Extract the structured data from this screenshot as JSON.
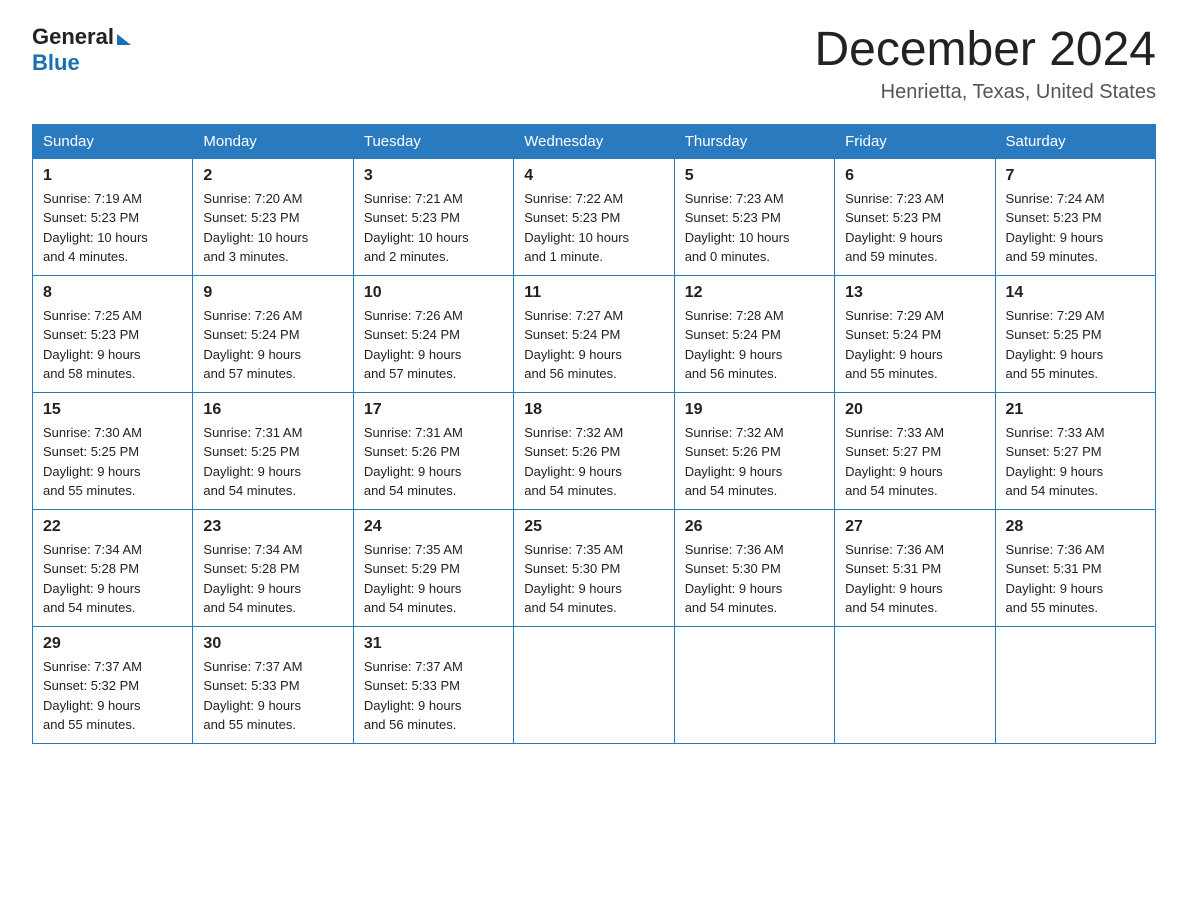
{
  "header": {
    "logo_general": "General",
    "logo_blue": "Blue",
    "title": "December 2024",
    "subtitle": "Henrietta, Texas, United States"
  },
  "days_of_week": [
    "Sunday",
    "Monday",
    "Tuesday",
    "Wednesday",
    "Thursday",
    "Friday",
    "Saturday"
  ],
  "weeks": [
    [
      {
        "day": "1",
        "sunrise": "Sunrise: 7:19 AM",
        "sunset": "Sunset: 5:23 PM",
        "daylight": "Daylight: 10 hours",
        "daylight2": "and 4 minutes."
      },
      {
        "day": "2",
        "sunrise": "Sunrise: 7:20 AM",
        "sunset": "Sunset: 5:23 PM",
        "daylight": "Daylight: 10 hours",
        "daylight2": "and 3 minutes."
      },
      {
        "day": "3",
        "sunrise": "Sunrise: 7:21 AM",
        "sunset": "Sunset: 5:23 PM",
        "daylight": "Daylight: 10 hours",
        "daylight2": "and 2 minutes."
      },
      {
        "day": "4",
        "sunrise": "Sunrise: 7:22 AM",
        "sunset": "Sunset: 5:23 PM",
        "daylight": "Daylight: 10 hours",
        "daylight2": "and 1 minute."
      },
      {
        "day": "5",
        "sunrise": "Sunrise: 7:23 AM",
        "sunset": "Sunset: 5:23 PM",
        "daylight": "Daylight: 10 hours",
        "daylight2": "and 0 minutes."
      },
      {
        "day": "6",
        "sunrise": "Sunrise: 7:23 AM",
        "sunset": "Sunset: 5:23 PM",
        "daylight": "Daylight: 9 hours",
        "daylight2": "and 59 minutes."
      },
      {
        "day": "7",
        "sunrise": "Sunrise: 7:24 AM",
        "sunset": "Sunset: 5:23 PM",
        "daylight": "Daylight: 9 hours",
        "daylight2": "and 59 minutes."
      }
    ],
    [
      {
        "day": "8",
        "sunrise": "Sunrise: 7:25 AM",
        "sunset": "Sunset: 5:23 PM",
        "daylight": "Daylight: 9 hours",
        "daylight2": "and 58 minutes."
      },
      {
        "day": "9",
        "sunrise": "Sunrise: 7:26 AM",
        "sunset": "Sunset: 5:24 PM",
        "daylight": "Daylight: 9 hours",
        "daylight2": "and 57 minutes."
      },
      {
        "day": "10",
        "sunrise": "Sunrise: 7:26 AM",
        "sunset": "Sunset: 5:24 PM",
        "daylight": "Daylight: 9 hours",
        "daylight2": "and 57 minutes."
      },
      {
        "day": "11",
        "sunrise": "Sunrise: 7:27 AM",
        "sunset": "Sunset: 5:24 PM",
        "daylight": "Daylight: 9 hours",
        "daylight2": "and 56 minutes."
      },
      {
        "day": "12",
        "sunrise": "Sunrise: 7:28 AM",
        "sunset": "Sunset: 5:24 PM",
        "daylight": "Daylight: 9 hours",
        "daylight2": "and 56 minutes."
      },
      {
        "day": "13",
        "sunrise": "Sunrise: 7:29 AM",
        "sunset": "Sunset: 5:24 PM",
        "daylight": "Daylight: 9 hours",
        "daylight2": "and 55 minutes."
      },
      {
        "day": "14",
        "sunrise": "Sunrise: 7:29 AM",
        "sunset": "Sunset: 5:25 PM",
        "daylight": "Daylight: 9 hours",
        "daylight2": "and 55 minutes."
      }
    ],
    [
      {
        "day": "15",
        "sunrise": "Sunrise: 7:30 AM",
        "sunset": "Sunset: 5:25 PM",
        "daylight": "Daylight: 9 hours",
        "daylight2": "and 55 minutes."
      },
      {
        "day": "16",
        "sunrise": "Sunrise: 7:31 AM",
        "sunset": "Sunset: 5:25 PM",
        "daylight": "Daylight: 9 hours",
        "daylight2": "and 54 minutes."
      },
      {
        "day": "17",
        "sunrise": "Sunrise: 7:31 AM",
        "sunset": "Sunset: 5:26 PM",
        "daylight": "Daylight: 9 hours",
        "daylight2": "and 54 minutes."
      },
      {
        "day": "18",
        "sunrise": "Sunrise: 7:32 AM",
        "sunset": "Sunset: 5:26 PM",
        "daylight": "Daylight: 9 hours",
        "daylight2": "and 54 minutes."
      },
      {
        "day": "19",
        "sunrise": "Sunrise: 7:32 AM",
        "sunset": "Sunset: 5:26 PM",
        "daylight": "Daylight: 9 hours",
        "daylight2": "and 54 minutes."
      },
      {
        "day": "20",
        "sunrise": "Sunrise: 7:33 AM",
        "sunset": "Sunset: 5:27 PM",
        "daylight": "Daylight: 9 hours",
        "daylight2": "and 54 minutes."
      },
      {
        "day": "21",
        "sunrise": "Sunrise: 7:33 AM",
        "sunset": "Sunset: 5:27 PM",
        "daylight": "Daylight: 9 hours",
        "daylight2": "and 54 minutes."
      }
    ],
    [
      {
        "day": "22",
        "sunrise": "Sunrise: 7:34 AM",
        "sunset": "Sunset: 5:28 PM",
        "daylight": "Daylight: 9 hours",
        "daylight2": "and 54 minutes."
      },
      {
        "day": "23",
        "sunrise": "Sunrise: 7:34 AM",
        "sunset": "Sunset: 5:28 PM",
        "daylight": "Daylight: 9 hours",
        "daylight2": "and 54 minutes."
      },
      {
        "day": "24",
        "sunrise": "Sunrise: 7:35 AM",
        "sunset": "Sunset: 5:29 PM",
        "daylight": "Daylight: 9 hours",
        "daylight2": "and 54 minutes."
      },
      {
        "day": "25",
        "sunrise": "Sunrise: 7:35 AM",
        "sunset": "Sunset: 5:30 PM",
        "daylight": "Daylight: 9 hours",
        "daylight2": "and 54 minutes."
      },
      {
        "day": "26",
        "sunrise": "Sunrise: 7:36 AM",
        "sunset": "Sunset: 5:30 PM",
        "daylight": "Daylight: 9 hours",
        "daylight2": "and 54 minutes."
      },
      {
        "day": "27",
        "sunrise": "Sunrise: 7:36 AM",
        "sunset": "Sunset: 5:31 PM",
        "daylight": "Daylight: 9 hours",
        "daylight2": "and 54 minutes."
      },
      {
        "day": "28",
        "sunrise": "Sunrise: 7:36 AM",
        "sunset": "Sunset: 5:31 PM",
        "daylight": "Daylight: 9 hours",
        "daylight2": "and 55 minutes."
      }
    ],
    [
      {
        "day": "29",
        "sunrise": "Sunrise: 7:37 AM",
        "sunset": "Sunset: 5:32 PM",
        "daylight": "Daylight: 9 hours",
        "daylight2": "and 55 minutes."
      },
      {
        "day": "30",
        "sunrise": "Sunrise: 7:37 AM",
        "sunset": "Sunset: 5:33 PM",
        "daylight": "Daylight: 9 hours",
        "daylight2": "and 55 minutes."
      },
      {
        "day": "31",
        "sunrise": "Sunrise: 7:37 AM",
        "sunset": "Sunset: 5:33 PM",
        "daylight": "Daylight: 9 hours",
        "daylight2": "and 56 minutes."
      },
      null,
      null,
      null,
      null
    ]
  ]
}
